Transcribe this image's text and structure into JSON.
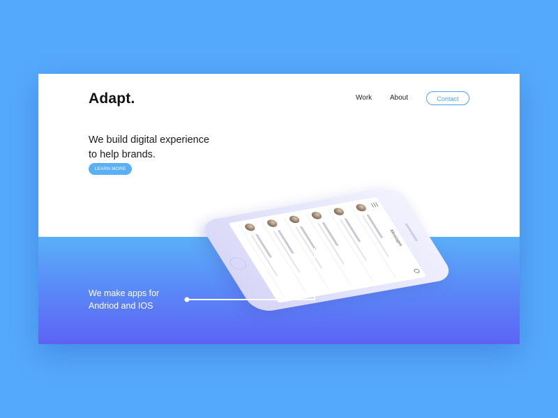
{
  "header": {
    "logo": "Adapt.",
    "nav": {
      "work": "Work",
      "about": "About",
      "contact": "Contact"
    }
  },
  "hero": {
    "headline_line1": "We build digital experience",
    "headline_line2": "to help brands.",
    "cta_label": "LEARN MORE"
  },
  "apps_section": {
    "line1": "We make apps for",
    "line2": "Andriod and IOS"
  },
  "colors": {
    "page_background": "#55a9fc",
    "accent": "#4aa3f5",
    "gradient_top": "#5aaff8",
    "gradient_bottom": "#5d63f4"
  },
  "phone": {
    "screen_title": "Messages"
  }
}
